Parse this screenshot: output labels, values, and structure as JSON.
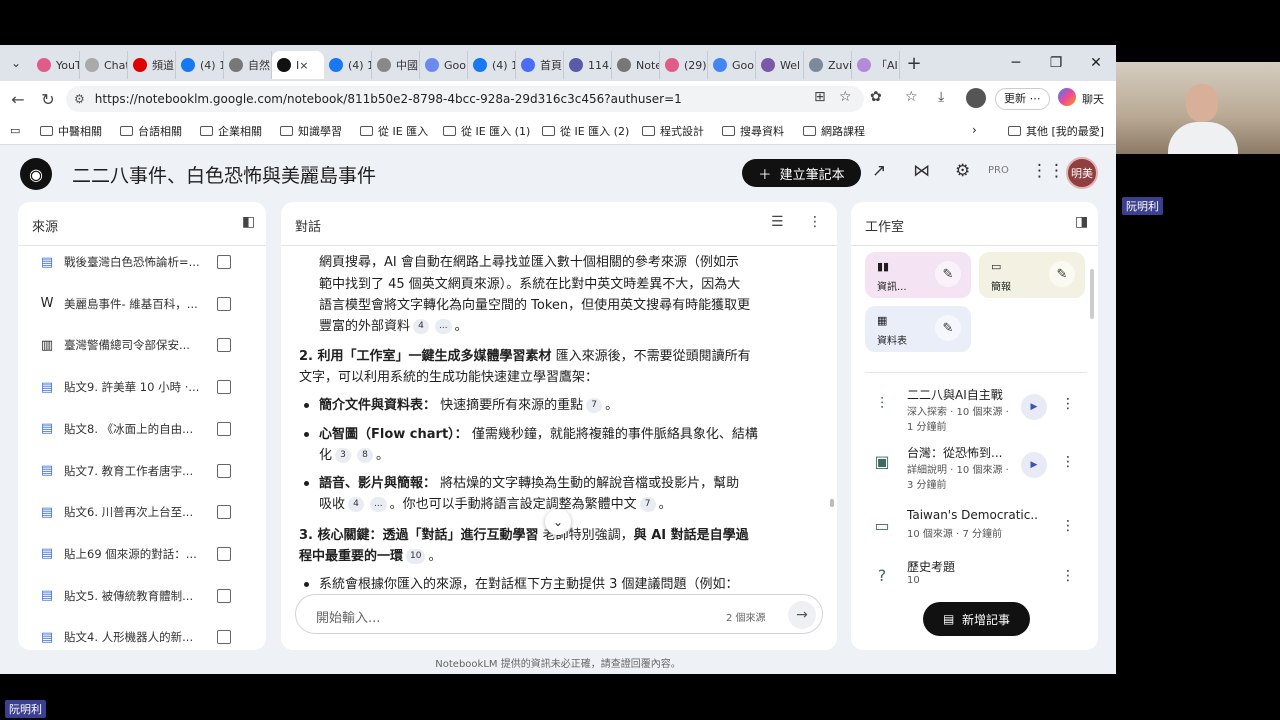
{
  "browser": {
    "tabs": [
      {
        "label": "YouT",
        "color": "#e05a8a"
      },
      {
        "label": "Chat",
        "color": "#aaaaaa"
      },
      {
        "label": "頻道",
        "color": "#e00000"
      },
      {
        "label": "(4) 1",
        "color": "#1877f2"
      },
      {
        "label": "自然",
        "color": "#777777"
      },
      {
        "label": "I×",
        "color": "#111111"
      },
      {
        "label": "(4) 1",
        "color": "#1877f2"
      },
      {
        "label": "中國",
        "color": "#888888"
      },
      {
        "label": "Goo",
        "color": "#6b8af0"
      },
      {
        "label": "(4) 1",
        "color": "#1877f2"
      },
      {
        "label": "首頁",
        "color": "#4a6cf7"
      },
      {
        "label": "114.",
        "color": "#5a5aa8"
      },
      {
        "label": "Note",
        "color": "#777777"
      },
      {
        "label": "(29)",
        "color": "#e05a8a"
      },
      {
        "label": "Goo",
        "color": "#4285f4"
      },
      {
        "label": "Wel",
        "color": "#7a5aa8"
      },
      {
        "label": "Zuvi",
        "color": "#7a8a9a"
      },
      {
        "label": "「AI",
        "color": "#b48ad8"
      }
    ],
    "url": "https://notebooklm.google.com/notebook/811b50e2-8798-4bcc-928a-29d316c3c456?authuser=1",
    "update_label": "更新",
    "chat_label": "聊天",
    "bookmarks": [
      "中醫相關",
      "台語相關",
      "企業相關",
      "知識學習",
      "從 IE 匯入",
      "從 IE 匯入 (1)",
      "從 IE 匯入 (2)",
      "程式設計",
      "搜尋資料",
      "網路課程"
    ],
    "other_bookmarks": "其他 [我的最愛]"
  },
  "app": {
    "title": "二二八事件、白色恐怖與美麗島事件",
    "new_notebook": "建立筆記本",
    "pro": "PRO",
    "avatar": "明美",
    "footer": "NotebookLM 提供的資訊未必正確，請查證回覆內容。"
  },
  "sources": {
    "title": "來源",
    "items": [
      {
        "icon": "document-icon",
        "label": "戰後臺灣白色恐怖論析=..."
      },
      {
        "icon": "wikipedia-icon",
        "label": "美麗島事件- 維基百科，..."
      },
      {
        "icon": "building-icon",
        "label": "臺灣警備總司令部保安..."
      },
      {
        "icon": "document-icon",
        "label": "貼文9. 許美華 10 小時 ·..."
      },
      {
        "icon": "document-icon",
        "label": "貼文8. 《冰面上的自由..."
      },
      {
        "icon": "document-icon",
        "label": "貼文7. 教育工作者唐宇..."
      },
      {
        "icon": "document-icon",
        "label": "貼文6. 川普再次上台至..."
      },
      {
        "icon": "document-icon",
        "label": "貼上69 個來源的對話：..."
      },
      {
        "icon": "document-icon",
        "label": "貼文5. 被傳統教育體制..."
      },
      {
        "icon": "document-icon",
        "label": "貼文4. 人形機器人的新..."
      }
    ]
  },
  "chat": {
    "title": "對話",
    "para1_line1": "網頁搜尋，AI 會自動在網路上尋找並匯入數十個相關的參考來源（例如示",
    "para1_line2": "範中找到了 45 個英文網頁來源）。系統在比對中英文時差異不大，因為大",
    "para1_line3": "語言模型會將文字轉化為向量空間的 Token，但使用英文搜尋有時能獲取更",
    "para1_line4": "豐富的外部資料",
    "cite_4": "4",
    "cite_more": "...",
    "period": "。",
    "h2_bold": "2. 利用「工作室」一鍵生成多媒體學習素材",
    "h2_rest": "匯入來源後，不需要從頭閱讀所有",
    "h2_line2": "文字，可以利用系統的生成功能快速建立學習鷹架：",
    "b1_bold": "簡介文件與資料表：",
    "b1_rest": "快速摘要所有來源的重點",
    "cite_7": "7",
    "b2_bold": "心智圖（Flow chart）：",
    "b2_rest": "僅需幾秒鐘，就能將複雜的事件脈絡具象化、結構",
    "b2_line2": "化",
    "cite_3": "3",
    "cite_8": "8",
    "b3_bold": "語音、影片與簡報：",
    "b3_rest": "將枯燥的文字轉換為生動的解說音檔或投影片，幫助",
    "b3_line2": "吸收",
    "b3_line2b": "。你也可以手動將語言設定調整為繁體中文",
    "h3_bold": "3. 核心關鍵：透過「對話」進行互動學習",
    "h3_rest": "老師特別強調，",
    "h3_bold2": "與 AI 對話是自學過",
    "h3_line2": "程中最重要的一環",
    "cite_10": "10",
    "b4": "系統會根據你匯入的來源，在對話框下方主動提供 3 個建議問題（例如：",
    "input_placeholder": "開始輸入...",
    "source_count": "2 個來源"
  },
  "studio": {
    "title": "工作室",
    "cards": [
      {
        "icon": "chart-icon",
        "label": "資訊...",
        "color": "#f3e3f3"
      },
      {
        "icon": "slides-icon",
        "label": "簡報",
        "color": "#f3f1e2"
      },
      {
        "icon": "table-icon",
        "label": "資料表",
        "color": "#e9eef8"
      }
    ],
    "outputs": [
      {
        "icon": "audio-icon",
        "title": "二二八與AI自主戰",
        "sub": "深入探索 · 10 個來源 ·",
        "sub2": "1 分鐘前",
        "play": true
      },
      {
        "icon": "video-icon",
        "title": "台灣：從恐怖到...",
        "sub": "詳細說明 · 10 個來源 ·",
        "sub2": "3 分鐘前",
        "play": true
      },
      {
        "icon": "slides-icon",
        "title": "Taiwan's Democratic...",
        "sub": "10 個來源 · 7 分鐘前",
        "sub2": "",
        "play": false
      },
      {
        "icon": "quiz-icon",
        "title": "歷史考題",
        "sub": "10",
        "sub2": "",
        "play": false
      }
    ],
    "new_note": "新增記事"
  },
  "video_call": {
    "name_top": "阮明利",
    "name_bottom": "阮明利"
  }
}
